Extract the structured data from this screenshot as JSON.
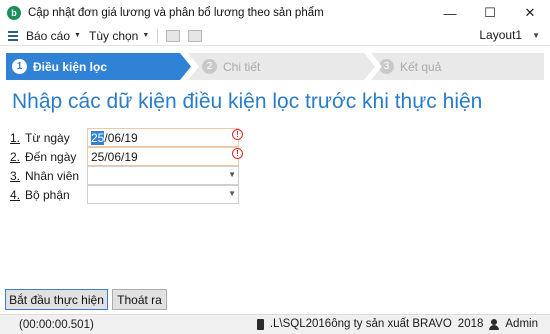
{
  "window": {
    "title": "Cập nhật đơn giá lương và phân bổ lương theo sản phẩm",
    "icon_letter": "b",
    "minimize": "—",
    "maximize": "☐",
    "close": "✕"
  },
  "toolbar": {
    "menu_report": "Báo cáo",
    "menu_options": "Tùy chọn",
    "layout": "Layout1"
  },
  "steps": [
    {
      "num": "1",
      "label": "Điều kiện lọc",
      "active": true
    },
    {
      "num": "2",
      "label": "Chi tiết",
      "active": false
    },
    {
      "num": "3",
      "label": "Kết quả",
      "active": false
    }
  ],
  "heading": "Nhập các dữ kiện điều kiện lọc trước khi thực hiện",
  "fields": [
    {
      "num": "1.",
      "label": "Từ ngày",
      "value_hl": "25",
      "value_rest": "/06/19",
      "error_icon": "!"
    },
    {
      "num": "2.",
      "label": "Đến ngày",
      "value": "25/06/19",
      "error_icon": "!"
    },
    {
      "num": "3.",
      "label": "Nhân viên",
      "value": ""
    },
    {
      "num": "4.",
      "label": "Bộ phận",
      "value": ""
    }
  ],
  "buttons": {
    "start": "Bắt đầu thực hiện",
    "exit": "Thoát ra"
  },
  "status": {
    "timer": "(00:00:00.501)",
    "database": ".L\\SQL2016ông ty sản xuất BRAVO",
    "year": "2018",
    "user": "Admin"
  },
  "colors": {
    "accent": "#2f82d6",
    "heading": "#2a7dc8",
    "error": "#d62d2d",
    "app_icon": "#1e8f5a"
  }
}
